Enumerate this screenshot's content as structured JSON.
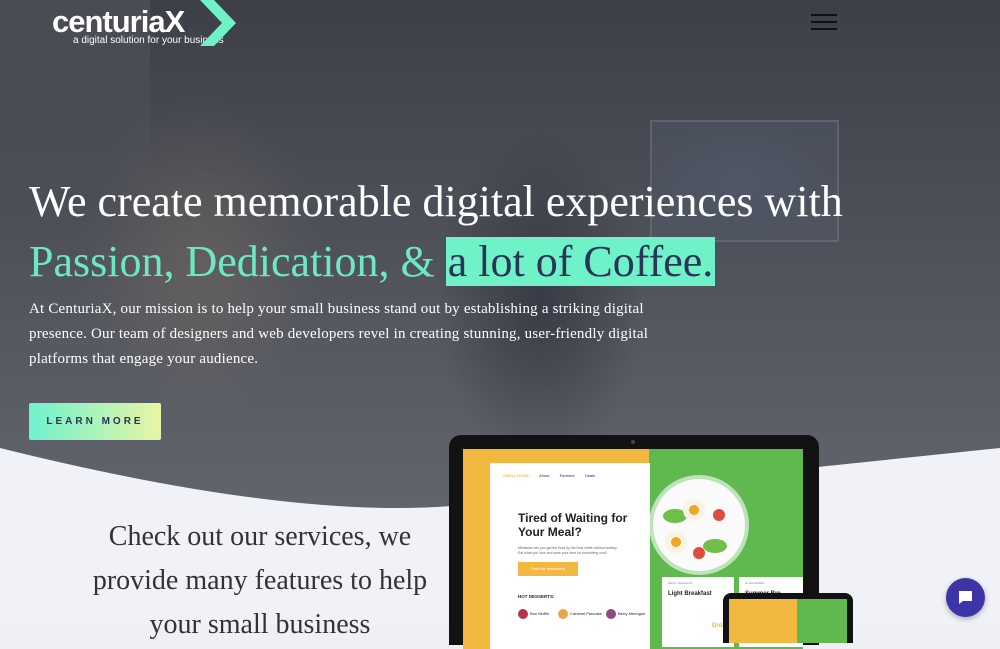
{
  "brand": {
    "name": "centuriaX",
    "tagline": "a digital solution for your business",
    "accent_color": "#6ff2c8",
    "navy_color": "#2b3557"
  },
  "nav": {
    "menu_icon": "hamburger-menu-icon"
  },
  "hero": {
    "headline_line1": "We create memorable digital experiences with",
    "headline_accent": "Passion, Dedication, &",
    "headline_highlight": "a lot of Coffee.",
    "mission": "At CenturiaX, our mission is to help your small business stand out by establishing a striking digital presence. Our team of designers and web developers revel in creating stunning, user-friendly digital platforms that engage your audience.",
    "cta_label": "LEARN MORE"
  },
  "services": {
    "intro": "Check out our services, we provide many features to help your small business"
  },
  "mockup": {
    "nav": [
      "SMALL HOME",
      "About",
      "Partners",
      "Deals"
    ],
    "title": "Tired of Waiting for Your Meal?",
    "subtitle": "Mealwise lets you get the food by the best chefs without waiting. Eat what you love and save your time for something cool!",
    "button": "Find the restaurant",
    "hot_label": "HOT DESSERTS:",
    "desserts": [
      {
        "name": "Bon Muffin",
        "color": "#b8324a"
      },
      {
        "name": "Caramel Pancake",
        "color": "#e8a74d"
      },
      {
        "name": "Berry Meringue",
        "color": "#8e4a7a"
      }
    ],
    "card1": {
      "tag": "Maxon Restaurant",
      "title": "Light Breakfast",
      "price": "Order"
    },
    "card2": {
      "tag": "Double Bubble",
      "title": "Summer Bre"
    }
  },
  "chat": {
    "icon": "chat-bubble-icon"
  }
}
